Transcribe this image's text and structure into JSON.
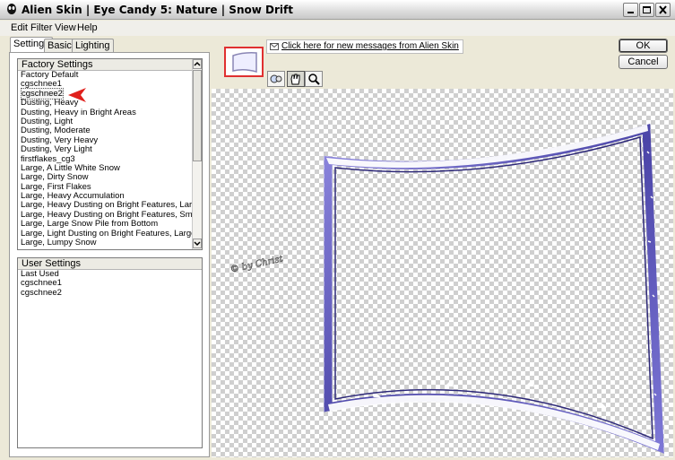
{
  "window": {
    "title": "Alien Skin | Eye Candy 5: Nature | Snow Drift"
  },
  "menu": [
    "Edit",
    "Filter",
    "View",
    "Help"
  ],
  "tabs": [
    "Settings",
    "Basic",
    "Lighting"
  ],
  "factory_settings": {
    "header": "Factory Settings",
    "items": [
      "Factory Default",
      "cgschnee1",
      "cgschnee2",
      "Dusting, Heavy",
      "Dusting, Heavy in Bright Areas",
      "Dusting, Light",
      "Dusting, Moderate",
      "Dusting, Very Heavy",
      "Dusting, Very Light",
      "firstflakes_cg3",
      "Large, A Little White Snow",
      "Large, Dirty Snow",
      "Large, First Flakes",
      "Large, Heavy Accumulation",
      "Large, Heavy Dusting on Bright Features, Large Drift",
      "Large, Heavy Dusting on Bright Features, Small Drift",
      "Large, Large Snow Pile from Bottom",
      "Large, Light Dusting on Bright Features, Large Drift",
      "Large, Lumpy Snow"
    ],
    "selected": "cgschnee2"
  },
  "user_settings": {
    "header": "User Settings",
    "items": [
      "Last Used",
      "cgschnee1",
      "cgschnee2"
    ]
  },
  "message_link": "Click here for new messages from Alien Skin",
  "buttons": {
    "ok": "OK",
    "cancel": "Cancel"
  },
  "tools": [
    "navigate-preview-icon",
    "hand-icon",
    "zoom-icon"
  ],
  "watermark": "© by Christa",
  "colors": {
    "frame": "#6a63c8",
    "selection_arrow": "#e0201c"
  }
}
